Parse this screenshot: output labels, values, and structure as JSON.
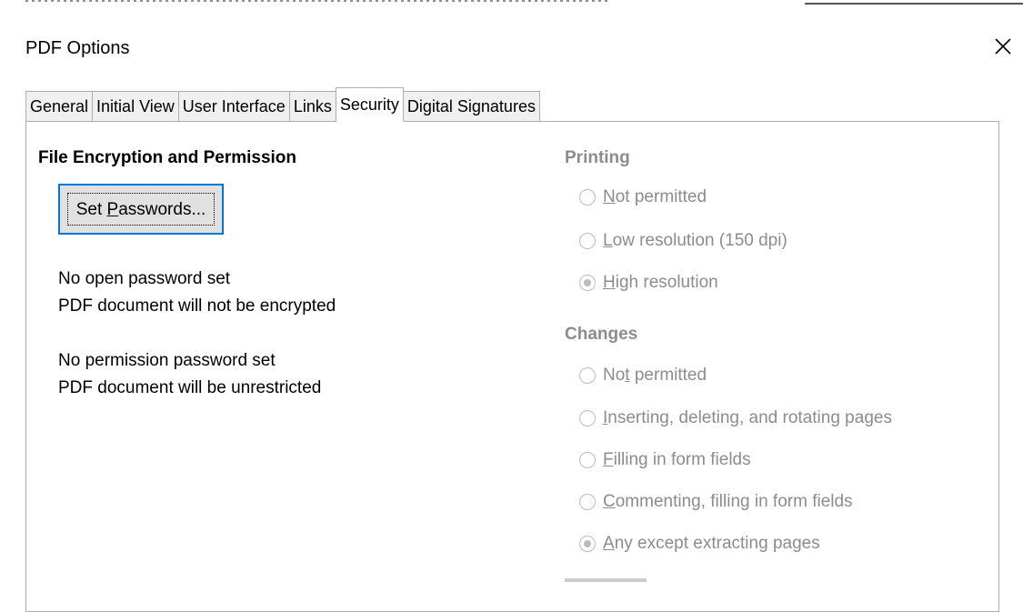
{
  "window": {
    "title": "PDF Options"
  },
  "tabs": [
    {
      "label": "General",
      "active": false
    },
    {
      "label": "Initial View",
      "active": false
    },
    {
      "label": "User Interface",
      "active": false
    },
    {
      "label": "Links",
      "active": false
    },
    {
      "label": "Security",
      "active": true
    },
    {
      "label": "Digital Signatures",
      "active": false
    }
  ],
  "encryption": {
    "title": "File Encryption and Permission",
    "set_passwords": {
      "pre": "Set ",
      "key": "P",
      "post": "asswords..."
    },
    "open_status_1": "No open password set",
    "open_status_2": "PDF document will not be encrypted",
    "perm_status_1": "No permission password set",
    "perm_status_2": "PDF document will be unrestricted"
  },
  "printing": {
    "title": "Printing",
    "options": [
      {
        "pre": "",
        "key": "N",
        "post": "ot permitted",
        "checked": false
      },
      {
        "pre": "",
        "key": "L",
        "post": "ow resolution (150 dpi)",
        "checked": false
      },
      {
        "pre": "",
        "key": "H",
        "post": "igh resolution",
        "checked": true
      }
    ]
  },
  "changes": {
    "title": "Changes",
    "options": [
      {
        "pre": "No",
        "key": "t",
        "post": " permitted",
        "checked": false
      },
      {
        "pre": "",
        "key": "I",
        "post": "nserting, deleting, and rotating pages",
        "checked": false
      },
      {
        "pre": "",
        "key": "F",
        "post": "illing in form fields",
        "checked": false
      },
      {
        "pre": "",
        "key": "C",
        "post": "ommenting, filling in form fields",
        "checked": false
      },
      {
        "pre": "",
        "key": "A",
        "post": "ny except extracting pages",
        "checked": true
      }
    ]
  },
  "colors": {
    "accent": "#0078d7",
    "disabled_text": "#8c8c8c"
  }
}
